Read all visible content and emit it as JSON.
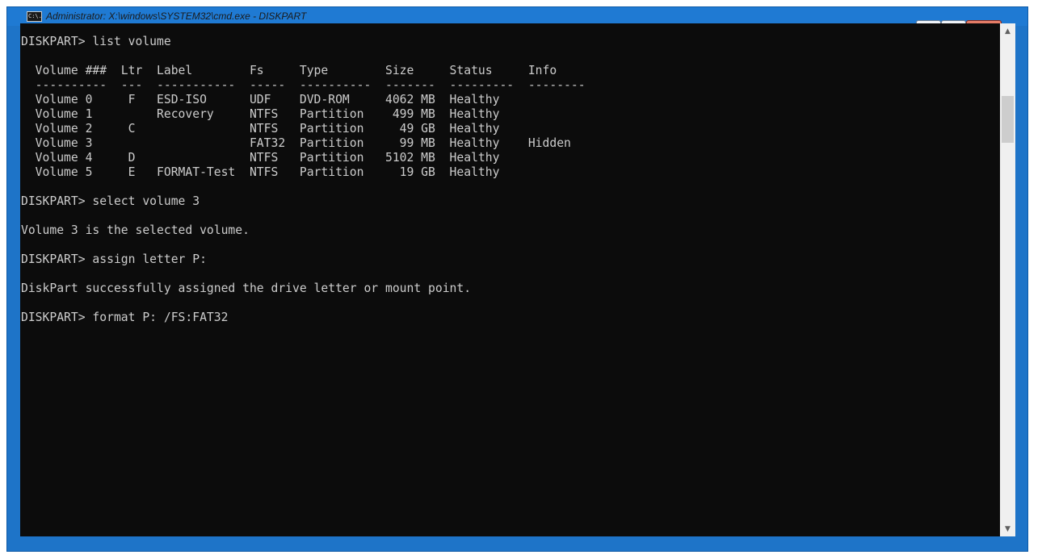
{
  "window": {
    "title": "Administrator: X:\\windows\\SYSTEM32\\cmd.exe - DISKPART",
    "icon_name": "cmd-icon",
    "icon_text": "C:\\.",
    "minimize_label": "▭",
    "maximize_label": "▢",
    "close_label": "✕"
  },
  "console": {
    "lines": [
      "DISKPART> list volume",
      "",
      "  Volume ###  Ltr  Label        Fs     Type        Size     Status     Info",
      "  ----------  ---  -----------  -----  ----------  -------  ---------  --------",
      "  Volume 0     F   ESD-ISO      UDF    DVD-ROM     4062 MB  Healthy",
      "  Volume 1         Recovery     NTFS   Partition    499 MB  Healthy",
      "  Volume 2     C                NTFS   Partition     49 GB  Healthy",
      "  Volume 3                      FAT32  Partition     99 MB  Healthy    Hidden",
      "  Volume 4     D                NTFS   Partition   5102 MB  Healthy",
      "  Volume 5     E   FORMAT-Test  NTFS   Partition     19 GB  Healthy",
      "",
      "DISKPART> select volume 3",
      "",
      "Volume 3 is the selected volume.",
      "",
      "DISKPART> assign letter P:",
      "",
      "DiskPart successfully assigned the drive letter or mount point.",
      "",
      "DISKPART> format P: /FS:FAT32"
    ]
  },
  "scrollbar": {
    "up_icon": "▲",
    "down_icon": "▼"
  },
  "colors": {
    "console_bg": "#0c0c0c",
    "console_fg": "#cccccc",
    "frame": "#1e74c8"
  }
}
